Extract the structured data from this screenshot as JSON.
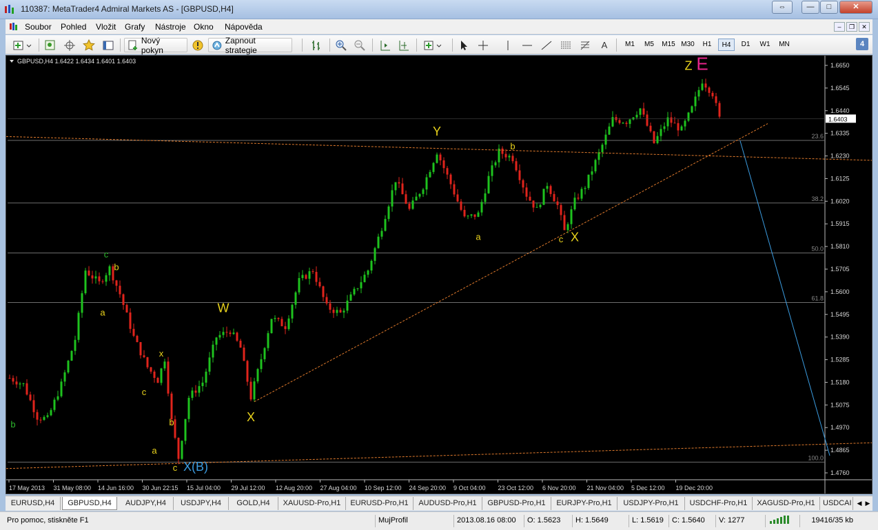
{
  "window": {
    "title": "110387: MetaTrader4 Admiral Markets AS - [GBPUSD,H4]",
    "controls": [
      "⇔",
      "—",
      "□",
      "✕"
    ]
  },
  "menu": [
    "Soubor",
    "Pohled",
    "Vložit",
    "Grafy",
    "Nástroje",
    "Okno",
    "Nápověda"
  ],
  "toolbar": {
    "new_order": "Nový pokyn",
    "strategies": "Zapnout strategie",
    "timeframes": [
      "M1",
      "M5",
      "M15",
      "M30",
      "H1",
      "H4",
      "D1",
      "W1",
      "MN"
    ],
    "active_timeframe": "H4",
    "badge": "4",
    "text_tool": "A"
  },
  "chart_data": {
    "type": "candlestick",
    "header": "GBPUSD,H4  1.6422 1.6434 1.6401 1.6403",
    "symbol": "GBPUSD,H4",
    "ohlc": [
      "1.6422",
      "1.6434",
      "1.6401",
      "1.6403"
    ],
    "current_price": "1.6403",
    "ylim": [
      1.476,
      1.665
    ],
    "y_ticks": [
      "1.6650",
      "1.6545",
      "1.6440",
      "1.6335",
      "1.6230",
      "1.6125",
      "1.6020",
      "1.5915",
      "1.5810",
      "1.5705",
      "1.5600",
      "1.5495",
      "1.5390",
      "1.5285",
      "1.5180",
      "1.5075",
      "1.4970",
      "1.4865",
      "1.4760"
    ],
    "x_ticks": [
      "17 May 2013",
      "31 May 08:00",
      "14 Jun 16:00",
      "30 Jun 22:15",
      "15 Jul 04:00",
      "29 Jul 12:00",
      "12 Aug 20:00",
      "27 Aug 04:00",
      "10 Sep 12:00",
      "24 Sep 20:00",
      "9 Oct 04:00",
      "23 Oct 12:00",
      "6 Nov 20:00",
      "21 Nov 04:00",
      "5 Dec 12:00",
      "19 Dec 20:00"
    ],
    "fib_levels": [
      {
        "label": "23.6",
        "value": 1.6302
      },
      {
        "label": "38.2",
        "value": 1.6012
      },
      {
        "label": "50.0",
        "value": 1.578
      },
      {
        "label": "61.8",
        "value": 1.555
      },
      {
        "label": "100.0",
        "value": 1.481
      }
    ],
    "wave_labels": [
      {
        "text": "b",
        "color": "#2db82d",
        "x": 1,
        "y": 1.497
      },
      {
        "text": "c",
        "color": "#2db82d",
        "x": 28,
        "y": 1.576
      },
      {
        "text": "b",
        "color": "#e8d21c",
        "x": 31,
        "y": 1.57
      },
      {
        "text": "a",
        "color": "#e8d21c",
        "x": 27,
        "y": 1.549
      },
      {
        "text": "x",
        "color": "#e8d21c",
        "x": 44,
        "y": 1.53
      },
      {
        "text": "c",
        "color": "#e8d21c",
        "x": 39,
        "y": 1.512
      },
      {
        "text": "b",
        "color": "#e8d21c",
        "x": 47,
        "y": 1.498
      },
      {
        "text": "a",
        "color": "#e8d21c",
        "x": 42,
        "y": 1.485
      },
      {
        "text": "c",
        "color": "#e8d21c",
        "x": 48,
        "y": 1.477
      },
      {
        "text": "X(B)",
        "color": "#3b9ce0",
        "x": 54,
        "y": 1.477
      },
      {
        "text": "W",
        "color": "#e8d21c",
        "x": 62,
        "y": 1.5505
      },
      {
        "text": "X",
        "color": "#e8d21c",
        "x": 70,
        "y": 1.5
      },
      {
        "text": "Y",
        "color": "#e8d21c",
        "x": 124,
        "y": 1.6325
      },
      {
        "text": "a",
        "color": "#e8d21c",
        "x": 136,
        "y": 1.584
      },
      {
        "text": "b",
        "color": "#e8d21c",
        "x": 146,
        "y": 1.626
      },
      {
        "text": "c",
        "color": "#e8d21c",
        "x": 160,
        "y": 1.583
      },
      {
        "text": "X",
        "color": "#e8d21c",
        "x": 164,
        "y": 1.5835
      },
      {
        "text": "Z",
        "color": "#e8d21c",
        "x": 197,
        "y": 1.663
      },
      {
        "text": "E",
        "color": "#e8248c",
        "x": 201,
        "y": 1.663
      }
    ],
    "path": [
      [
        0,
        1.52
      ],
      [
        4,
        1.517
      ],
      [
        8,
        1.502
      ],
      [
        11,
        1.501
      ],
      [
        15,
        1.517
      ],
      [
        19,
        1.538
      ],
      [
        22,
        1.57
      ],
      [
        26,
        1.564
      ],
      [
        29,
        1.571
      ],
      [
        32,
        1.559
      ],
      [
        36,
        1.539
      ],
      [
        40,
        1.525
      ],
      [
        43,
        1.519
      ],
      [
        45,
        1.529
      ],
      [
        47,
        1.5
      ],
      [
        49,
        1.483
      ],
      [
        52,
        1.511
      ],
      [
        56,
        1.518
      ],
      [
        60,
        1.539
      ],
      [
        64,
        1.542
      ],
      [
        67,
        1.534
      ],
      [
        70,
        1.511
      ],
      [
        73,
        1.529
      ],
      [
        76,
        1.548
      ],
      [
        80,
        1.544
      ],
      [
        84,
        1.565
      ],
      [
        88,
        1.57
      ],
      [
        92,
        1.553
      ],
      [
        96,
        1.55
      ],
      [
        100,
        1.56
      ],
      [
        104,
        1.57
      ],
      [
        108,
        1.59
      ],
      [
        112,
        1.612
      ],
      [
        116,
        1.598
      ],
      [
        120,
        1.609
      ],
      [
        124,
        1.625
      ],
      [
        128,
        1.61
      ],
      [
        132,
        1.594
      ],
      [
        136,
        1.596
      ],
      [
        139,
        1.613
      ],
      [
        142,
        1.625
      ],
      [
        146,
        1.622
      ],
      [
        150,
        1.605
      ],
      [
        153,
        1.598
      ],
      [
        156,
        1.61
      ],
      [
        159,
        1.6
      ],
      [
        161,
        1.588
      ],
      [
        164,
        1.602
      ],
      [
        167,
        1.609
      ],
      [
        171,
        1.624
      ],
      [
        175,
        1.64
      ],
      [
        179,
        1.639
      ],
      [
        183,
        1.645
      ],
      [
        187,
        1.629
      ],
      [
        191,
        1.64
      ],
      [
        195,
        1.635
      ],
      [
        198,
        1.645
      ],
      [
        201,
        1.658
      ],
      [
        204,
        1.652
      ],
      [
        206,
        1.6403
      ]
    ],
    "bars_total": 207,
    "trend_lines": [
      {
        "color": "#e07a2c",
        "from": [
          -1,
          1.632
        ],
        "to": [
          272,
          1.62
        ]
      },
      {
        "color": "#e07a2c",
        "from": [
          71,
          1.509
        ],
        "to": [
          220,
          1.638
        ]
      },
      {
        "color": "#e07a2c",
        "from": [
          -1,
          1.478
        ],
        "to": [
          272,
          1.491
        ]
      },
      {
        "color": "#3b9ce0",
        "from": [
          212,
          1.63
        ],
        "to": [
          238,
          1.484
        ]
      }
    ]
  },
  "tabs": {
    "items": [
      "EURUSD,H4",
      "GBPUSD,H4",
      "AUDJPY,H4",
      "USDJPY,H4",
      "GOLD,H4",
      "XAUUSD-Pro,H1",
      "EURUSD-Pro,H1",
      "AUDUSD-Pro,H1",
      "GBPUSD-Pro,H1",
      "EURJPY-Pro,H1",
      "USDJPY-Pro,H1",
      "USDCHF-Pro,H1",
      "XAGUSD-Pro,H1",
      "USDCAI"
    ],
    "active": "GBPUSD,H4"
  },
  "status": {
    "help": "Pro pomoc, stiskněte F1",
    "profile": "MujProfil",
    "datetime": "2013.08.16 08:00",
    "open": "O: 1.5623",
    "high": "H: 1.5649",
    "low": "L: 1.5619",
    "close": "C: 1.5640",
    "volume": "V: 1277",
    "traffic": "19416/35 kb"
  },
  "colors": {
    "bull": "#1ec21e",
    "bear": "#e0241c",
    "axis_text": "#d8d8d8",
    "grid_level": "#6e6e6e"
  }
}
